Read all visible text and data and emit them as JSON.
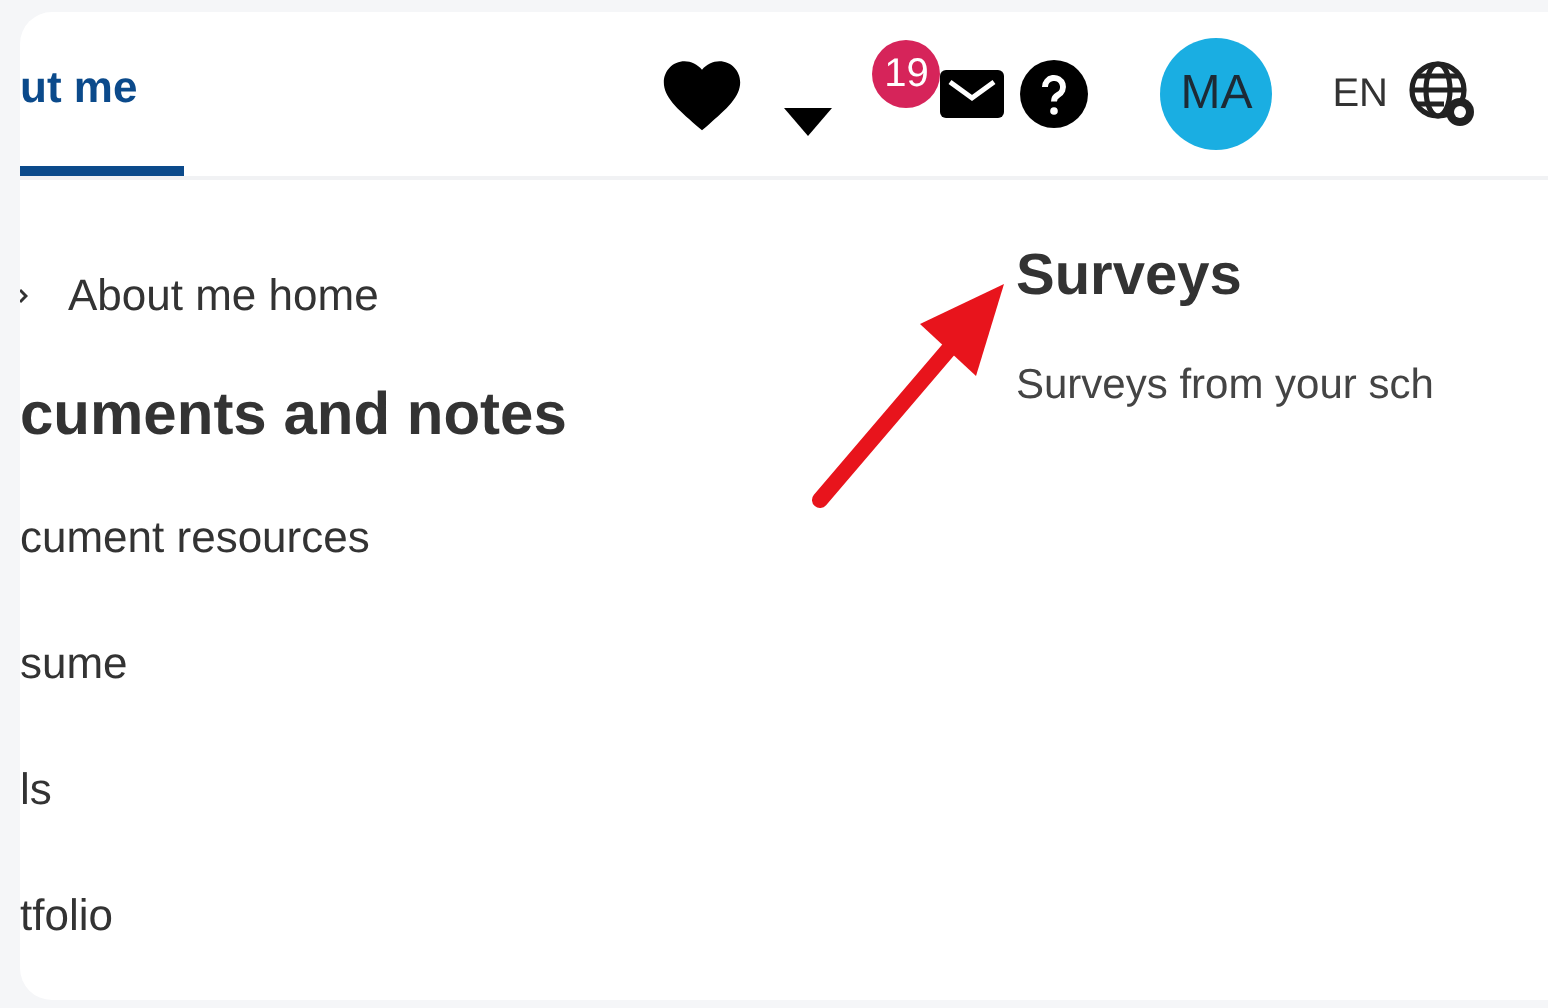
{
  "header": {
    "tabs": [
      {
        "label": "ut me",
        "selected": true
      }
    ],
    "notifications": {
      "count": "19"
    },
    "avatar": {
      "initials": "MA"
    },
    "language": "EN"
  },
  "sidebar": {
    "items": [
      {
        "kind": "home",
        "label": "About me home"
      },
      {
        "kind": "heading",
        "label": "cuments and notes"
      },
      {
        "kind": "link",
        "label": "cument resources"
      },
      {
        "kind": "link",
        "label": "sume"
      },
      {
        "kind": "link",
        "label": "ls"
      },
      {
        "kind": "link",
        "label": "tfolio"
      }
    ]
  },
  "content": {
    "title": "Surveys",
    "description": "Surveys from your sch"
  }
}
